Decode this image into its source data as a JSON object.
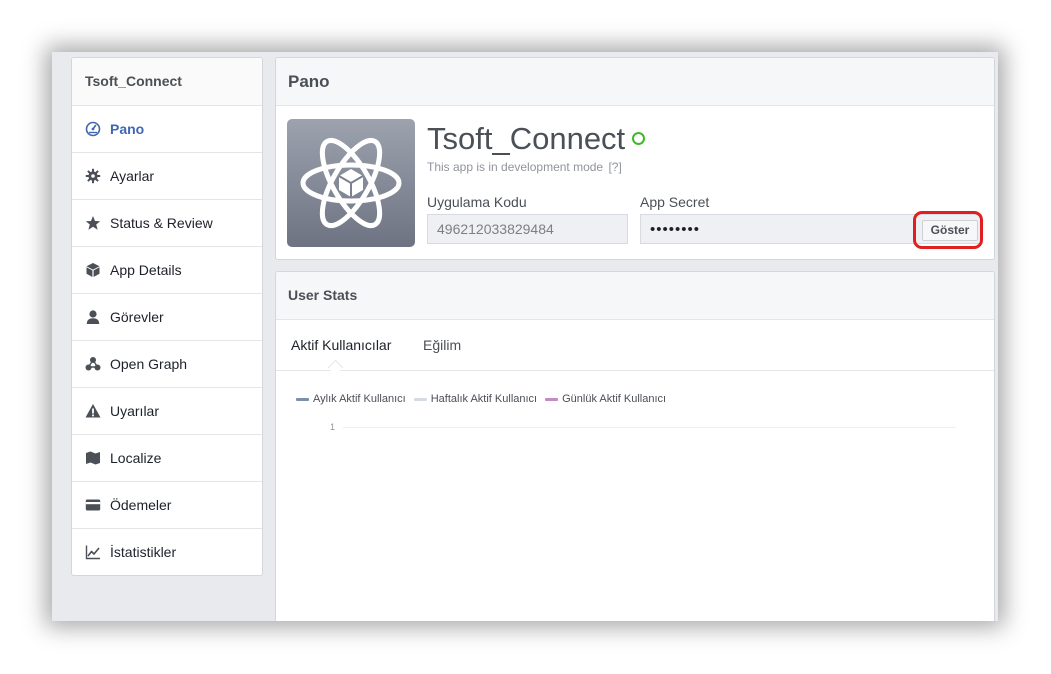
{
  "sidebar": {
    "title": "Tsoft_Connect",
    "items": [
      {
        "label": "Pano",
        "icon": "dashboard-icon",
        "active": true
      },
      {
        "label": "Ayarlar",
        "icon": "gear-icon"
      },
      {
        "label": "Status & Review",
        "icon": "star-icon"
      },
      {
        "label": "App Details",
        "icon": "cube-icon"
      },
      {
        "label": "Görevler",
        "icon": "user-icon"
      },
      {
        "label": "Open Graph",
        "icon": "graph-nodes-icon"
      },
      {
        "label": "Uyarılar",
        "icon": "warning-icon"
      },
      {
        "label": "Localize",
        "icon": "map-icon"
      },
      {
        "label": "Ödemeler",
        "icon": "credit-card-icon"
      },
      {
        "label": "İstatistikler",
        "icon": "chart-icon"
      }
    ]
  },
  "dashboard": {
    "header": "Pano",
    "app_name": "Tsoft_Connect",
    "dev_mode_text": "This app is in development mode",
    "help_label": "[?]",
    "app_id_label": "Uygulama Kodu",
    "app_id_value": "496212033829484",
    "app_secret_label": "App Secret",
    "app_secret_value": "••••••••",
    "show_button": "Göster"
  },
  "user_stats": {
    "header": "User Stats",
    "tabs": [
      "Aktif Kullanıcılar",
      "Eğilim"
    ],
    "legend": [
      {
        "name": "Aylık Aktif Kullanıcı",
        "color": "#7b8fae"
      },
      {
        "name": "Haftalık Aktif Kullanıcı",
        "color": "#d5dbe6"
      },
      {
        "name": "Günlük Aktif Kullanıcı",
        "color": "#c38bc6"
      }
    ],
    "y_tick": "1"
  }
}
